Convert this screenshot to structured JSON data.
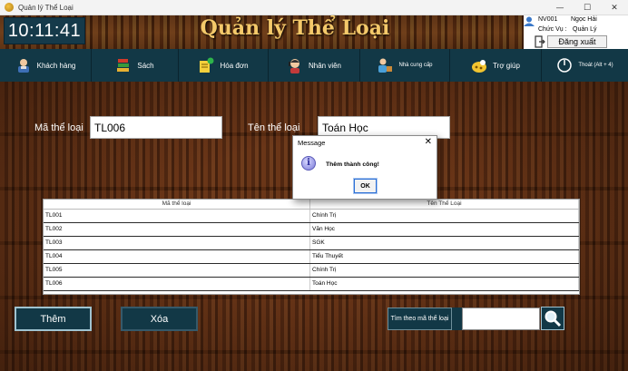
{
  "window": {
    "title": "Quản lý Thể Loại",
    "minimize": "—",
    "maximize": "☐",
    "close": "✕"
  },
  "header": {
    "clock": "10:11:41",
    "page_title": "Quản lý Thể Loại"
  },
  "user": {
    "id": "NV001",
    "name": "Ngọc Hải",
    "role_label": "Chức Vụ :",
    "role_value": "Quản Lý",
    "logout_label": "Đăng xuất"
  },
  "nav": {
    "items": [
      {
        "label": "Khách hàng",
        "icon": "customer-icon"
      },
      {
        "label": "Sách",
        "icon": "book-icon"
      },
      {
        "label": "Hóa đơn",
        "icon": "invoice-icon"
      },
      {
        "label": "Nhân viên",
        "icon": "staff-icon"
      },
      {
        "label": "Nhà cung cấp",
        "icon": "supplier-icon"
      },
      {
        "label": "Trợ giúp",
        "icon": "help-icon"
      },
      {
        "label": "Thoát (Alt + 4)",
        "icon": "exit-icon"
      }
    ]
  },
  "form": {
    "code_label": "Mã thể loại",
    "code_value": "TL006",
    "name_label": "Tên thể loại",
    "name_value": "Toán Học"
  },
  "table": {
    "headers": [
      "Mã thể loại",
      "Tên Thể Loại"
    ],
    "rows": [
      [
        "TL001",
        "Chính Trị"
      ],
      [
        "TL002",
        "Văn Học"
      ],
      [
        "TL003",
        "SGK"
      ],
      [
        "TL004",
        "Tiểu Thuyết"
      ],
      [
        "TL005",
        "Chính Trị"
      ],
      [
        "TL006",
        "Toán Học"
      ]
    ]
  },
  "actions": {
    "add_label": "Thêm",
    "delete_label": "Xóa",
    "search_label": "Tìm theo mã thể loại",
    "search_value": ""
  },
  "dialog": {
    "title": "Message",
    "message": "Thêm thành công!",
    "ok_label": "OK",
    "info_glyph": "i"
  },
  "colors": {
    "nav_bg": "#123846",
    "title_gold": "#f4c96a",
    "body_bg": "#5a2e16"
  }
}
